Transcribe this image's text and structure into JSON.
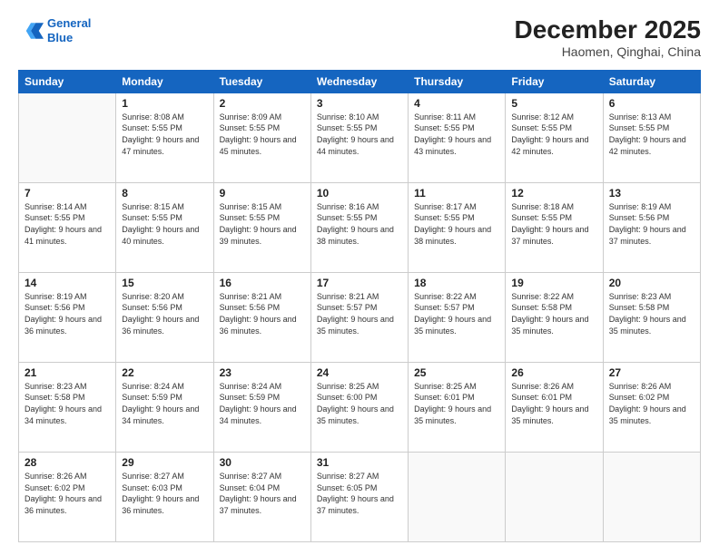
{
  "logo": {
    "line1": "General",
    "line2": "Blue"
  },
  "title": "December 2025",
  "subtitle": "Haomen, Qinghai, China",
  "days_of_week": [
    "Sunday",
    "Monday",
    "Tuesday",
    "Wednesday",
    "Thursday",
    "Friday",
    "Saturday"
  ],
  "weeks": [
    [
      {
        "day": "",
        "sunrise": "",
        "sunset": "",
        "daylight": ""
      },
      {
        "day": "1",
        "sunrise": "Sunrise: 8:08 AM",
        "sunset": "Sunset: 5:55 PM",
        "daylight": "Daylight: 9 hours and 47 minutes."
      },
      {
        "day": "2",
        "sunrise": "Sunrise: 8:09 AM",
        "sunset": "Sunset: 5:55 PM",
        "daylight": "Daylight: 9 hours and 45 minutes."
      },
      {
        "day": "3",
        "sunrise": "Sunrise: 8:10 AM",
        "sunset": "Sunset: 5:55 PM",
        "daylight": "Daylight: 9 hours and 44 minutes."
      },
      {
        "day": "4",
        "sunrise": "Sunrise: 8:11 AM",
        "sunset": "Sunset: 5:55 PM",
        "daylight": "Daylight: 9 hours and 43 minutes."
      },
      {
        "day": "5",
        "sunrise": "Sunrise: 8:12 AM",
        "sunset": "Sunset: 5:55 PM",
        "daylight": "Daylight: 9 hours and 42 minutes."
      },
      {
        "day": "6",
        "sunrise": "Sunrise: 8:13 AM",
        "sunset": "Sunset: 5:55 PM",
        "daylight": "Daylight: 9 hours and 42 minutes."
      }
    ],
    [
      {
        "day": "7",
        "sunrise": "Sunrise: 8:14 AM",
        "sunset": "Sunset: 5:55 PM",
        "daylight": "Daylight: 9 hours and 41 minutes."
      },
      {
        "day": "8",
        "sunrise": "Sunrise: 8:15 AM",
        "sunset": "Sunset: 5:55 PM",
        "daylight": "Daylight: 9 hours and 40 minutes."
      },
      {
        "day": "9",
        "sunrise": "Sunrise: 8:15 AM",
        "sunset": "Sunset: 5:55 PM",
        "daylight": "Daylight: 9 hours and 39 minutes."
      },
      {
        "day": "10",
        "sunrise": "Sunrise: 8:16 AM",
        "sunset": "Sunset: 5:55 PM",
        "daylight": "Daylight: 9 hours and 38 minutes."
      },
      {
        "day": "11",
        "sunrise": "Sunrise: 8:17 AM",
        "sunset": "Sunset: 5:55 PM",
        "daylight": "Daylight: 9 hours and 38 minutes."
      },
      {
        "day": "12",
        "sunrise": "Sunrise: 8:18 AM",
        "sunset": "Sunset: 5:55 PM",
        "daylight": "Daylight: 9 hours and 37 minutes."
      },
      {
        "day": "13",
        "sunrise": "Sunrise: 8:19 AM",
        "sunset": "Sunset: 5:56 PM",
        "daylight": "Daylight: 9 hours and 37 minutes."
      }
    ],
    [
      {
        "day": "14",
        "sunrise": "Sunrise: 8:19 AM",
        "sunset": "Sunset: 5:56 PM",
        "daylight": "Daylight: 9 hours and 36 minutes."
      },
      {
        "day": "15",
        "sunrise": "Sunrise: 8:20 AM",
        "sunset": "Sunset: 5:56 PM",
        "daylight": "Daylight: 9 hours and 36 minutes."
      },
      {
        "day": "16",
        "sunrise": "Sunrise: 8:21 AM",
        "sunset": "Sunset: 5:56 PM",
        "daylight": "Daylight: 9 hours and 36 minutes."
      },
      {
        "day": "17",
        "sunrise": "Sunrise: 8:21 AM",
        "sunset": "Sunset: 5:57 PM",
        "daylight": "Daylight: 9 hours and 35 minutes."
      },
      {
        "day": "18",
        "sunrise": "Sunrise: 8:22 AM",
        "sunset": "Sunset: 5:57 PM",
        "daylight": "Daylight: 9 hours and 35 minutes."
      },
      {
        "day": "19",
        "sunrise": "Sunrise: 8:22 AM",
        "sunset": "Sunset: 5:58 PM",
        "daylight": "Daylight: 9 hours and 35 minutes."
      },
      {
        "day": "20",
        "sunrise": "Sunrise: 8:23 AM",
        "sunset": "Sunset: 5:58 PM",
        "daylight": "Daylight: 9 hours and 35 minutes."
      }
    ],
    [
      {
        "day": "21",
        "sunrise": "Sunrise: 8:23 AM",
        "sunset": "Sunset: 5:58 PM",
        "daylight": "Daylight: 9 hours and 34 minutes."
      },
      {
        "day": "22",
        "sunrise": "Sunrise: 8:24 AM",
        "sunset": "Sunset: 5:59 PM",
        "daylight": "Daylight: 9 hours and 34 minutes."
      },
      {
        "day": "23",
        "sunrise": "Sunrise: 8:24 AM",
        "sunset": "Sunset: 5:59 PM",
        "daylight": "Daylight: 9 hours and 34 minutes."
      },
      {
        "day": "24",
        "sunrise": "Sunrise: 8:25 AM",
        "sunset": "Sunset: 6:00 PM",
        "daylight": "Daylight: 9 hours and 35 minutes."
      },
      {
        "day": "25",
        "sunrise": "Sunrise: 8:25 AM",
        "sunset": "Sunset: 6:01 PM",
        "daylight": "Daylight: 9 hours and 35 minutes."
      },
      {
        "day": "26",
        "sunrise": "Sunrise: 8:26 AM",
        "sunset": "Sunset: 6:01 PM",
        "daylight": "Daylight: 9 hours and 35 minutes."
      },
      {
        "day": "27",
        "sunrise": "Sunrise: 8:26 AM",
        "sunset": "Sunset: 6:02 PM",
        "daylight": "Daylight: 9 hours and 35 minutes."
      }
    ],
    [
      {
        "day": "28",
        "sunrise": "Sunrise: 8:26 AM",
        "sunset": "Sunset: 6:02 PM",
        "daylight": "Daylight: 9 hours and 36 minutes."
      },
      {
        "day": "29",
        "sunrise": "Sunrise: 8:27 AM",
        "sunset": "Sunset: 6:03 PM",
        "daylight": "Daylight: 9 hours and 36 minutes."
      },
      {
        "day": "30",
        "sunrise": "Sunrise: 8:27 AM",
        "sunset": "Sunset: 6:04 PM",
        "daylight": "Daylight: 9 hours and 37 minutes."
      },
      {
        "day": "31",
        "sunrise": "Sunrise: 8:27 AM",
        "sunset": "Sunset: 6:05 PM",
        "daylight": "Daylight: 9 hours and 37 minutes."
      },
      {
        "day": "",
        "sunrise": "",
        "sunset": "",
        "daylight": ""
      },
      {
        "day": "",
        "sunrise": "",
        "sunset": "",
        "daylight": ""
      },
      {
        "day": "",
        "sunrise": "",
        "sunset": "",
        "daylight": ""
      }
    ]
  ]
}
